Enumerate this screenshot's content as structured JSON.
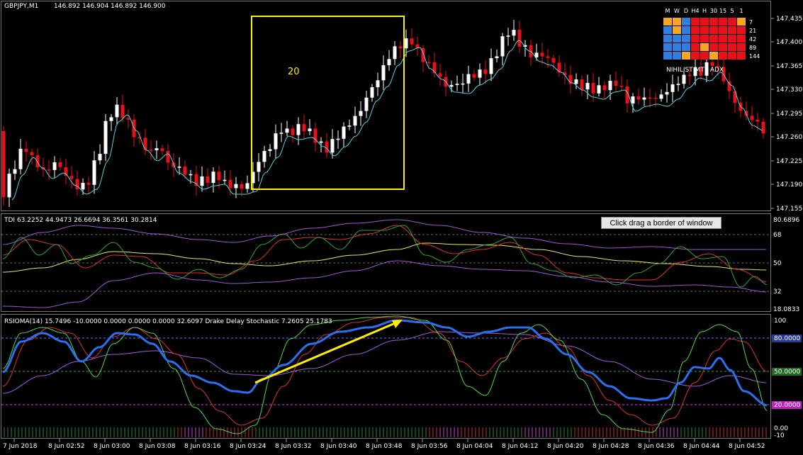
{
  "main_panel": {
    "symbol": "GBPJPY,M1",
    "ohlc": "146.892 146.904 146.892 146.900",
    "box_label": "20",
    "price_labels": [
      "147.435",
      "147.400",
      "147.365",
      "147.330",
      "147.295",
      "147.260",
      "147.225",
      "147.190",
      "147.155"
    ]
  },
  "mtf_grid": {
    "timeframes": [
      "M",
      "W",
      "D",
      "H4",
      "H",
      "30",
      "15",
      "5",
      "1"
    ],
    "periods": [
      "7",
      "21",
      "42",
      "89",
      "144"
    ],
    "legend": "NIHILIST MTF ADX",
    "cells": [
      [
        "o",
        "o",
        "b",
        "r",
        "r",
        "r",
        "r",
        "r",
        "o"
      ],
      [
        "b",
        "o",
        "b",
        "r",
        "r",
        "r",
        "r",
        "r",
        "r"
      ],
      [
        "b",
        "b",
        "b",
        "r",
        "r",
        "r",
        "r",
        "r",
        "r"
      ],
      [
        "b",
        "b",
        "b",
        "r",
        "o",
        "r",
        "r",
        "r",
        "r"
      ],
      [
        "b",
        "b",
        "o",
        "r",
        "r",
        "o",
        "r",
        "r",
        "r"
      ]
    ],
    "colors": {
      "o": "#f5a623",
      "b": "#2f7fe0",
      "r": "#e8101a"
    }
  },
  "tdi_panel": {
    "header": "TDI 63.2252 44.9473 26.6694 36.3561 30.2814",
    "levels": [
      "80.6896",
      "68",
      "50",
      "32",
      "18.0833"
    ]
  },
  "rsi_panel": {
    "header": "RSIOMA(14) 15.7496 -10.0000 0.0000 0.0000 0.0000 32.6097  Drake Delay Stochastic 7.2605 25.1783",
    "levels": [
      "100",
      "80.0000",
      "50.0000",
      "20.0000",
      "0.00",
      "-10"
    ]
  },
  "time_labels": [
    "7 Jun 2018",
    "8 Jun 02:52",
    "8 Jun 03:00",
    "8 Jun 03:08",
    "8 Jun 03:16",
    "8 Jun 03:24",
    "8 Jun 03:32",
    "8 Jun 03:40",
    "8 Jun 03:48",
    "8 Jun 03:56",
    "8 Jun 04:04",
    "8 Jun 04:12",
    "8 Jun 04:20",
    "8 Jun 04:28",
    "8 Jun 04:36",
    "8 Jun 04:44",
    "8 Jun 04:52"
  ],
  "tooltip": "Click  drag a border of window",
  "colors": {
    "bull": "#ffffff",
    "bear": "#e8101a",
    "ma": "#4fd2e0",
    "box": "#ffee00",
    "arrow": "#ffee00",
    "tdi_green": "#2fa52f",
    "tdi_red": "#e0302a",
    "tdi_yellow": "#e8e85a",
    "tdi_band": "#a055d8",
    "rsi_blue": "#2a6ff0",
    "rsi_green": "#4cd94c",
    "rsi_red": "#e0302a",
    "rsi_purple": "#a05ae0",
    "level_80": "#7070ff",
    "level_50": "#3aa83a",
    "level_20": "#e03ae0"
  }
}
